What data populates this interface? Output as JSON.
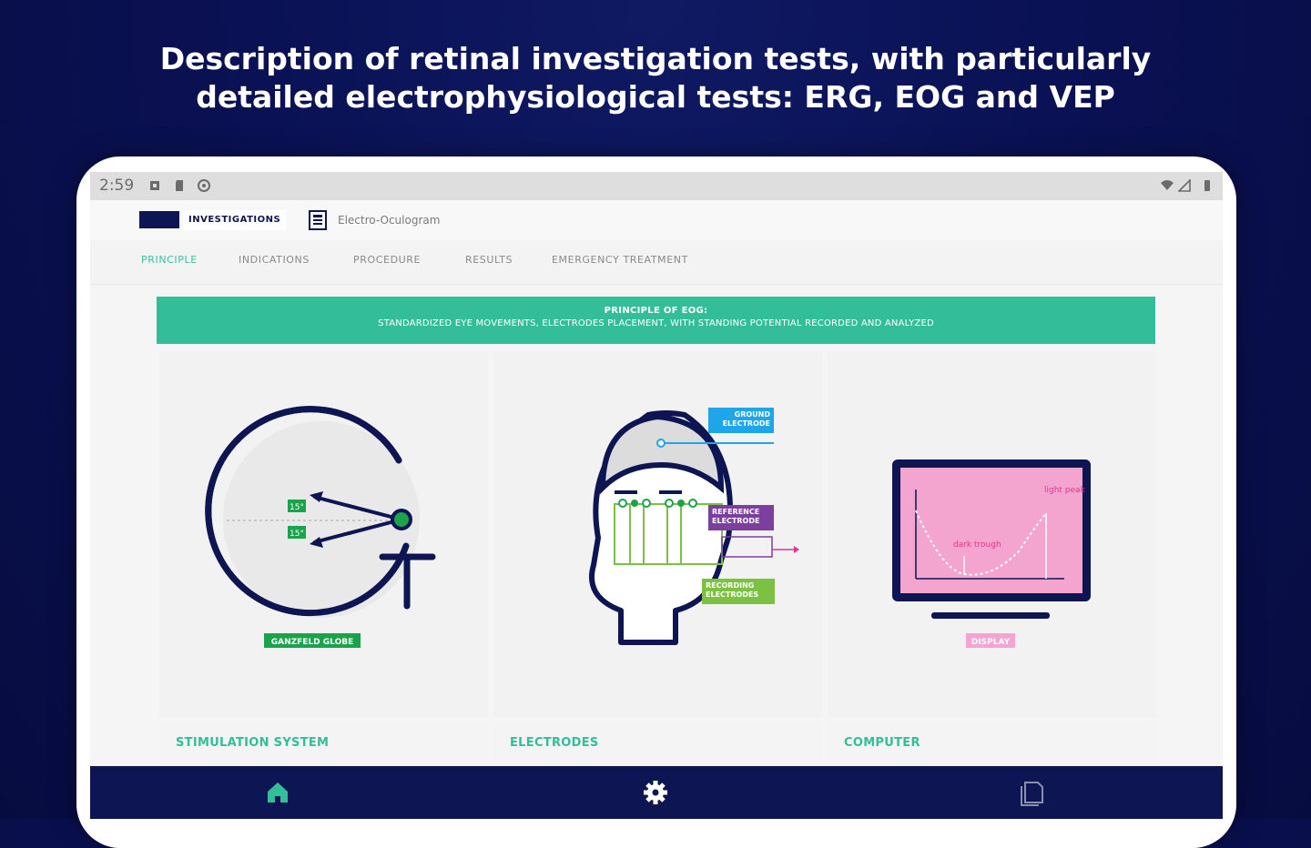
{
  "promo": {
    "line1": "Description of retinal investigation tests, with particularly",
    "line2": "detailed electrophysiological tests: ERG, EOG and VEP"
  },
  "statusbar": {
    "time": "2:59"
  },
  "appbar": {
    "section_label": "INVESTIGATIONS",
    "page_title": "Electro-Oculogram"
  },
  "tabs": [
    {
      "label": "PRINCIPLE",
      "active": true
    },
    {
      "label": "INDICATIONS",
      "active": false
    },
    {
      "label": "PROCEDURE",
      "active": false
    },
    {
      "label": "RESULTS",
      "active": false
    },
    {
      "label": "EMERGENCY TREATMENT",
      "active": false
    }
  ],
  "banner": {
    "title": "PRINCIPLE OF EOG:",
    "subtitle": "STANDARDIZED EYE MOVEMENTS, ELECTRODES PLACEMENT, WITH STANDING POTENTIAL RECORDED AND ANALYZED"
  },
  "cards": [
    {
      "caption": "STIMULATION SYSTEM",
      "tag": "GANZFELD GLOBE",
      "angle_top": "15°",
      "angle_bottom": "15°"
    },
    {
      "caption": "ELECTRODES",
      "tag_ground": "GROUND ELECTRODE",
      "tag_reference": "REFERENCE ELECTRODE",
      "tag_recording": "RECORDING ELECTRODES"
    },
    {
      "caption": "COMPUTER",
      "tag": "DISPLAY",
      "light_peak": "light peak",
      "dark_trough": "dark trough"
    }
  ],
  "colors": {
    "navy": "#0d1552",
    "teal": "#33bd98",
    "green": "#1aa34a",
    "pink": "#f3a4cf",
    "magenta": "#e0358f",
    "blue": "#1fa6e8",
    "purple": "#7b3fa0",
    "lime": "#7cc242"
  },
  "bottom_nav": [
    {
      "icon": "home-icon",
      "active": true
    },
    {
      "icon": "gear-icon",
      "active": false
    },
    {
      "icon": "pages-icon",
      "active": false
    }
  ]
}
